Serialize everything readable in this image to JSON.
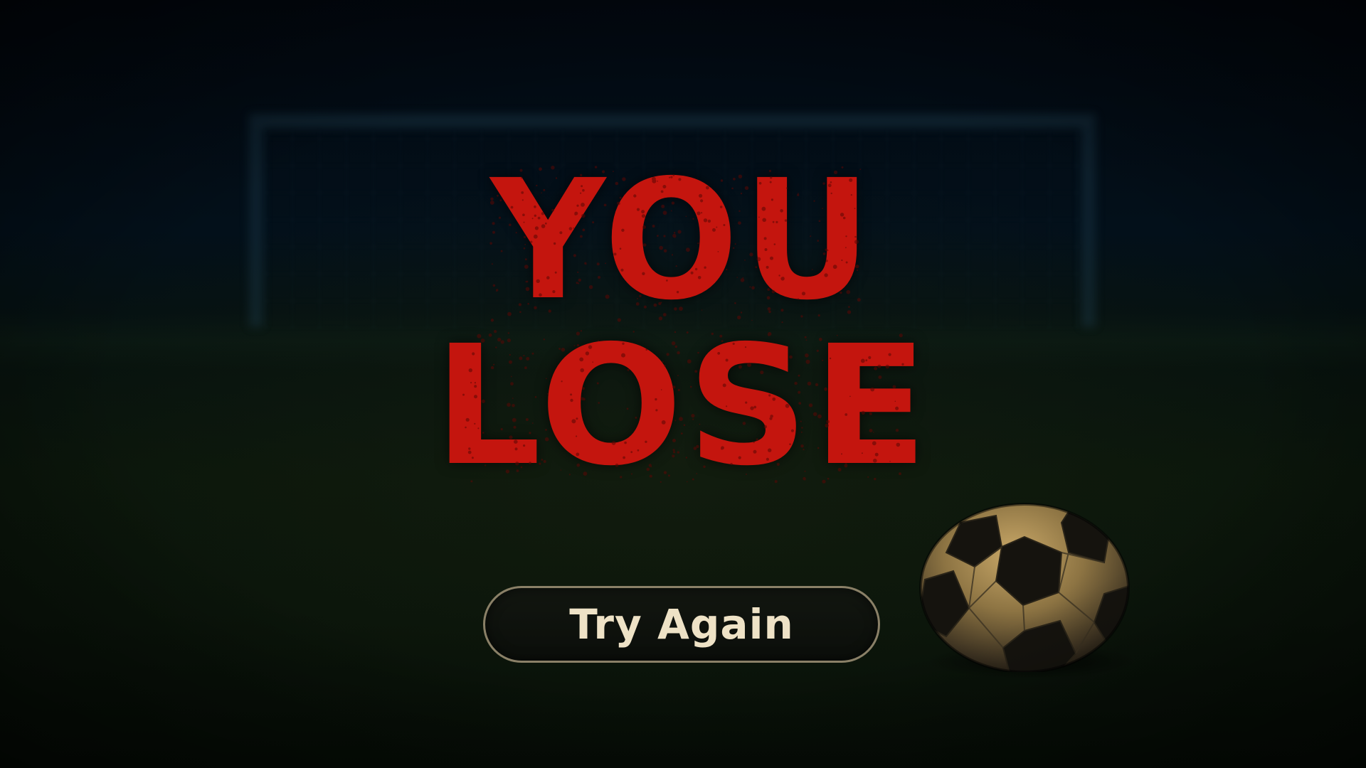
{
  "screen": {
    "title_line1": "YOU",
    "title_line2": "LOSE",
    "title_color": "#c4150e"
  },
  "actions": {
    "try_again_label": "Try Again"
  },
  "scene": {
    "background_icon": "soccer-goal-icon",
    "ball_icon": "soccer-ball-icon",
    "button_text_color": "#eee2c6",
    "button_border_color": "#8a8067"
  }
}
